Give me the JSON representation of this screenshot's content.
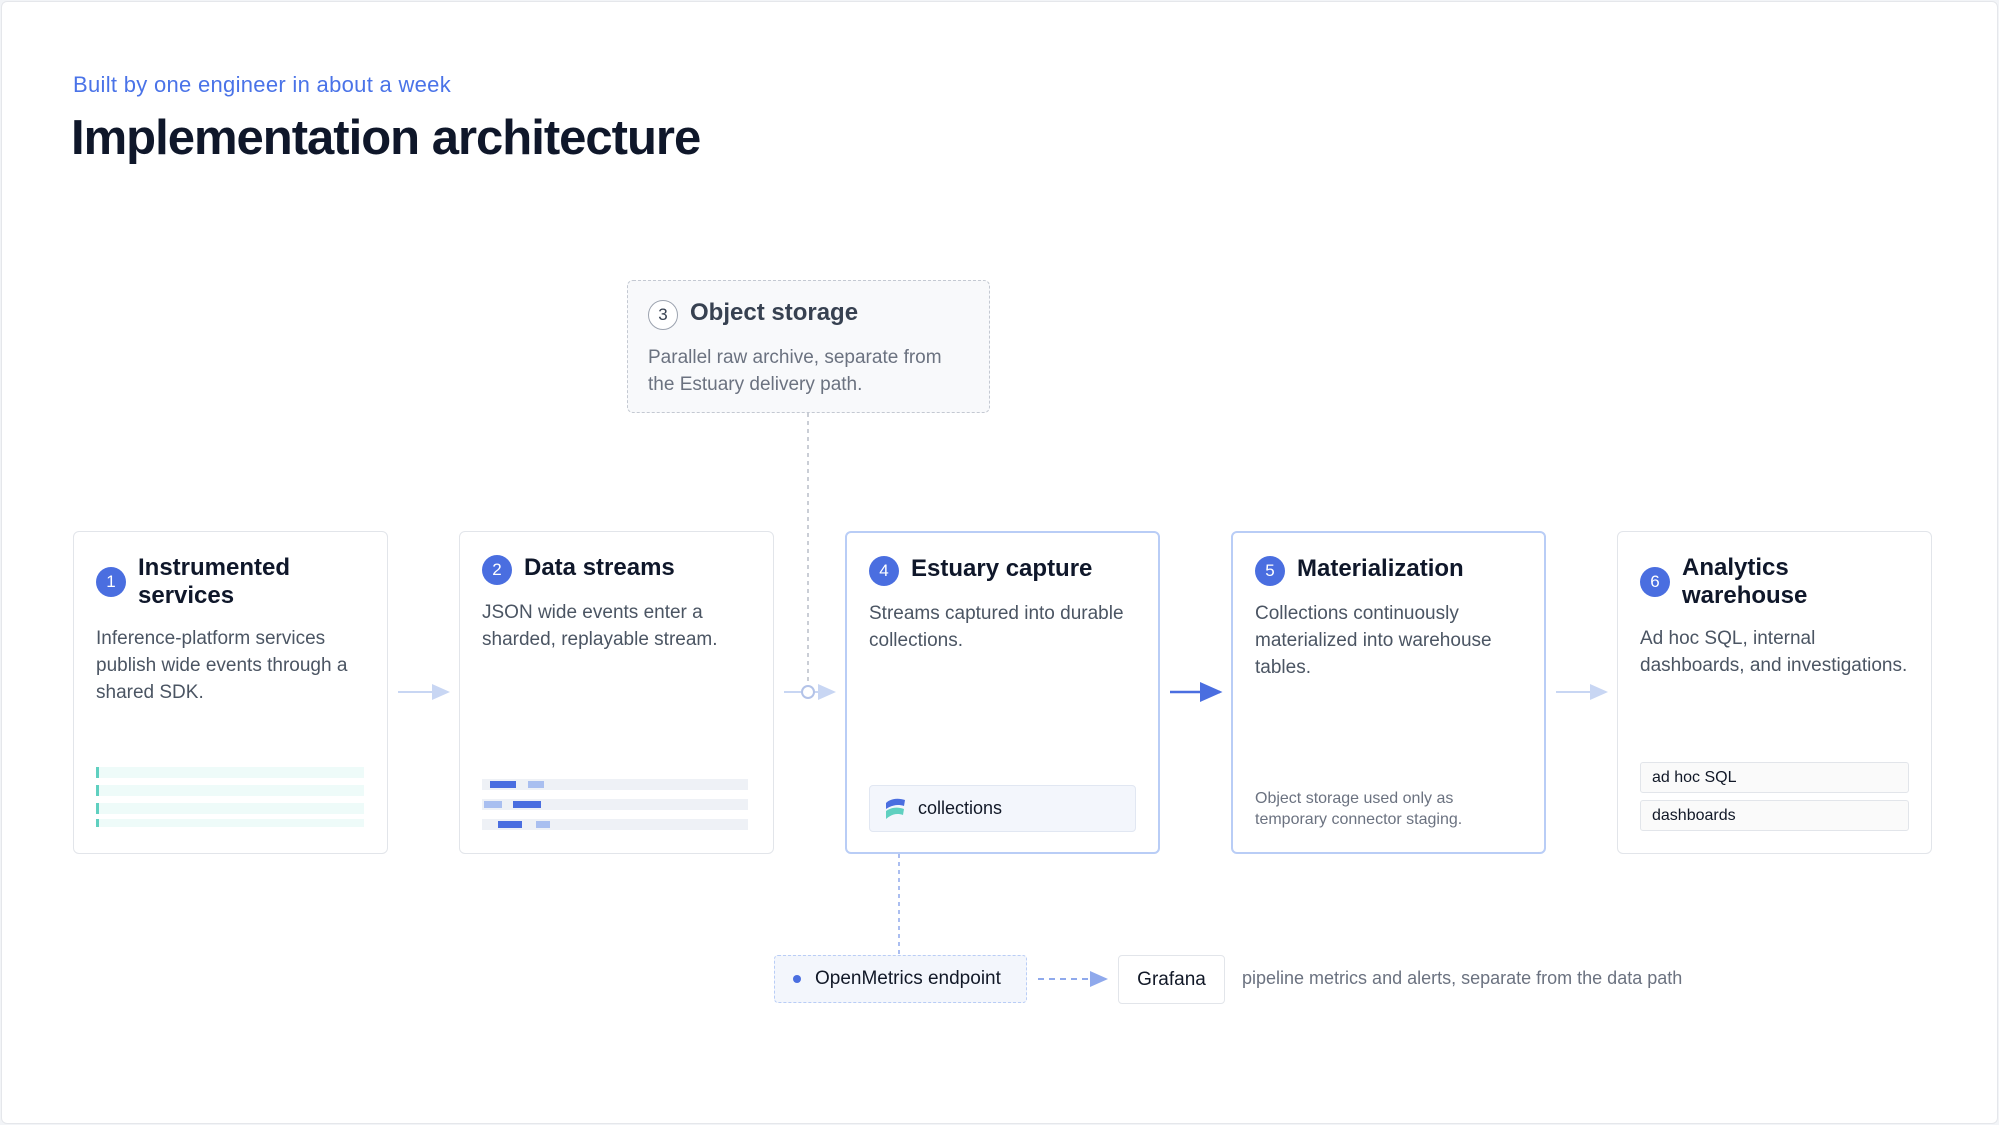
{
  "header": {
    "eyebrow": "Built by one engineer in about a week",
    "title": "Implementation architecture"
  },
  "object_storage": {
    "number": "3",
    "title": "Object storage",
    "description": "Parallel raw archive, separate from the Estuary delivery path."
  },
  "steps": [
    {
      "number": "1",
      "title": "Instrumented services",
      "description": "Inference-platform services publish wide events through a shared SDK."
    },
    {
      "number": "2",
      "title": "Data streams",
      "description": "JSON wide events enter a sharded, replayable stream."
    },
    {
      "number": "4",
      "title": "Estuary capture",
      "description": "Streams captured into durable collections.",
      "pill_label": "collections"
    },
    {
      "number": "5",
      "title": "Materialization",
      "description": "Collections continuously materialized into warehouse tables.",
      "note": "Object storage used only as temporary connector staging."
    },
    {
      "number": "6",
      "title": "Analytics warehouse",
      "description": "Ad hoc SQL, internal dashboards, and investigations.",
      "tags": [
        "ad hoc SQL",
        "dashboards"
      ]
    }
  ],
  "monitoring": {
    "endpoint_label": "OpenMetrics endpoint",
    "target_label": "Grafana",
    "note": "pipeline metrics and alerts, separate from the data path"
  },
  "colors": {
    "accent": "#4a6ee0",
    "eyebrow": "#4a73e8",
    "connector_light": "#c8d6f3",
    "connector_strong": "#4a6ee0",
    "teal": "#5fd0c0"
  }
}
